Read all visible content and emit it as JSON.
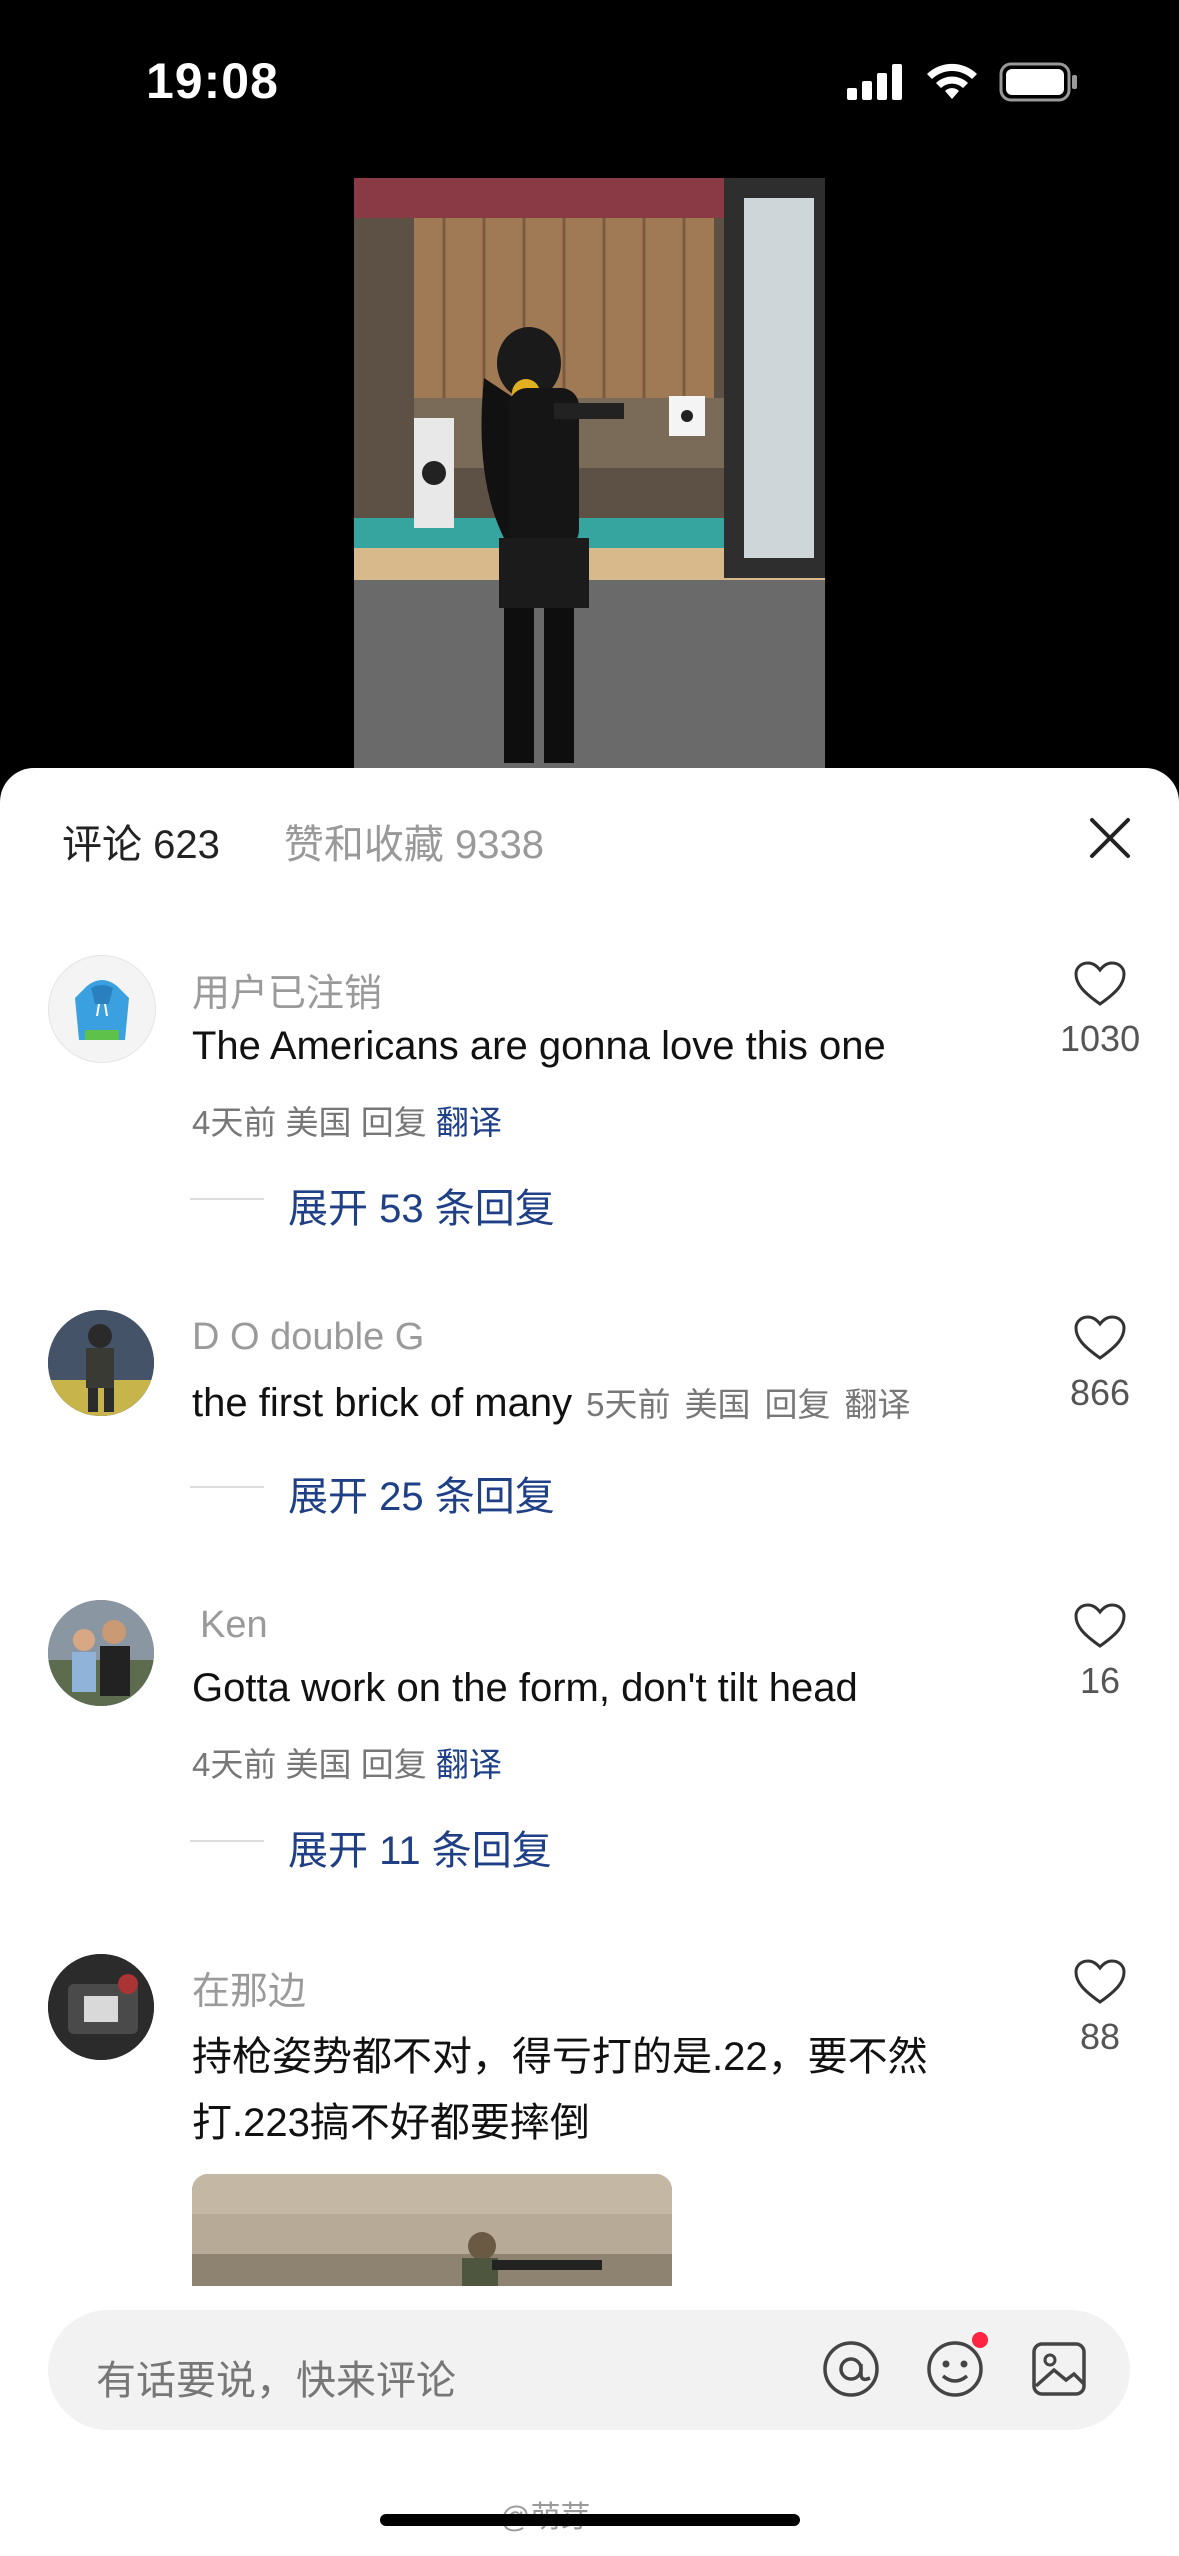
{
  "status": {
    "time": "19:08"
  },
  "tabs": {
    "comments": "评论 623",
    "likes": "赞和收藏 9338"
  },
  "comments": [
    {
      "user": "用户已注销",
      "text": "The Americans are gonna love this one",
      "meta_time": "4天前",
      "meta_region": "美国",
      "reply": "回复",
      "translate": "翻译",
      "likes": "1030",
      "expand": "展开 53 条回复"
    },
    {
      "user": "D O double G",
      "text": "the first brick of many",
      "meta_time": "5天前",
      "meta_region": "美国",
      "reply": "回复",
      "translate": "翻译",
      "likes": "866",
      "expand": "展开 25 条回复"
    },
    {
      "user": "Ken",
      "text": "Gotta work on the form, don't tilt head",
      "meta_time": "4天前",
      "meta_region": "美国",
      "reply": "回复",
      "translate": "翻译",
      "likes": "16",
      "expand": "展开 11 条回复"
    },
    {
      "user": "在那边",
      "text_line1": "持枪姿势都不对，得亏打的是.22，要不然",
      "text_line2": "打.223搞不好都要摔倒",
      "likes": "88"
    }
  ],
  "input": {
    "placeholder": "有话要说，快来评论"
  },
  "watermark": "@萌芽"
}
